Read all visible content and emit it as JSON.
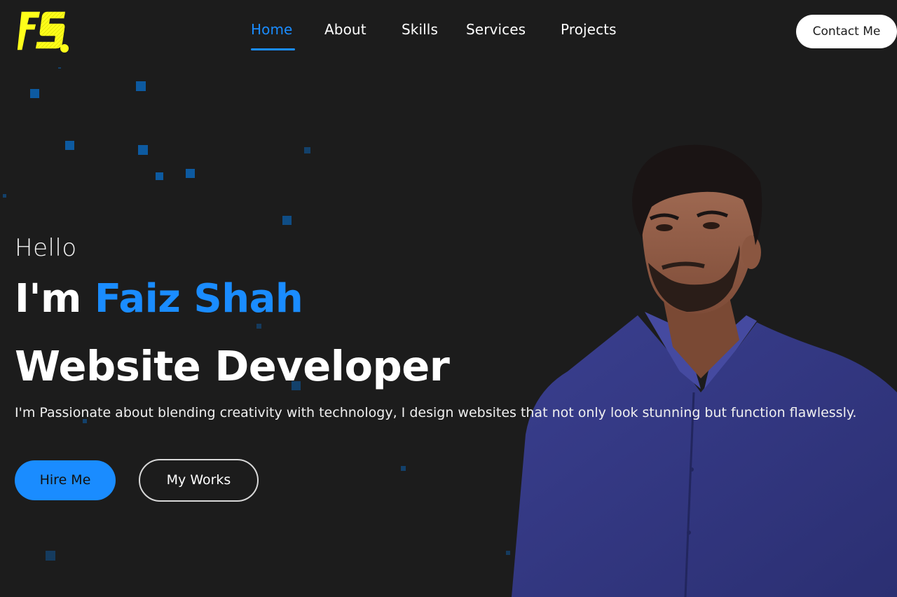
{
  "brand": {
    "logo_text": "FS",
    "logo_color": "#ffff1a"
  },
  "nav": {
    "items": [
      {
        "label": "Home",
        "active": true
      },
      {
        "label": "About",
        "active": false
      },
      {
        "label": "Skills",
        "active": false
      },
      {
        "label": "Services",
        "active": false
      },
      {
        "label": "Projects",
        "active": false
      }
    ],
    "contact_label": "Contact Me"
  },
  "hero": {
    "greeting": "Hello",
    "intro_prefix": "I'm",
    "name": "Faiz Shah",
    "role": "Website Developer",
    "description": "I'm Passionate about blending creativity with technology, I design websites that not only look stunning but function flawlessly.",
    "hire_label": "Hire Me",
    "works_label": "My Works"
  },
  "colors": {
    "background": "#1c1c1c",
    "accent": "#1a8cff",
    "text": "#ffffff",
    "particle": "#0d5aa0"
  }
}
